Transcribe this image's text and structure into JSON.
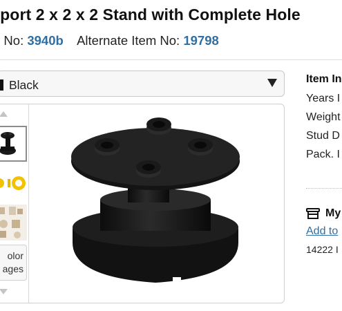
{
  "header": {
    "title": "pport 2 x 2 x 2 Stand with Complete Hole",
    "item_no_label": "n No:",
    "item_no": "3940b",
    "alt_label": "Alternate Item No:",
    "alt_no": "19798"
  },
  "color_select": {
    "selected": "Black",
    "swatch_color": "#111111"
  },
  "gallery": {
    "thumbnails": [
      {
        "name": "stand-black-thumb"
      },
      {
        "name": "yellow-parts-thumb"
      },
      {
        "name": "set-image-thumb"
      }
    ],
    "color_images_label_line1": "olor",
    "color_images_label_line2": "ages"
  },
  "info_panel": {
    "title": "Item In",
    "rows": [
      "Years I",
      "Weight",
      "Stud D",
      "Pack. I"
    ]
  },
  "my_store": {
    "title": "My",
    "add_link": "Add to",
    "count_text": "14222 I"
  },
  "colors": {
    "link": "#2f6fa3",
    "part": "#111111"
  }
}
